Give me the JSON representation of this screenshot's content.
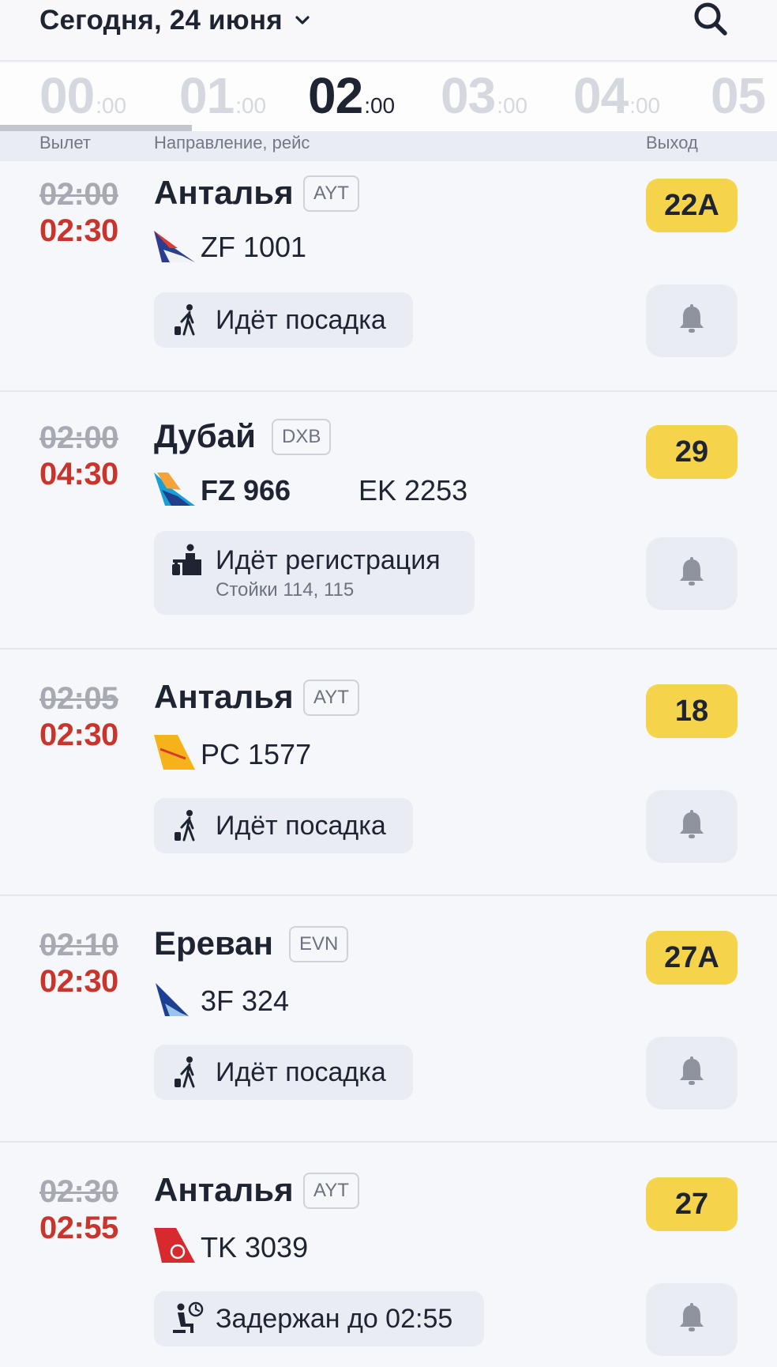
{
  "header": {
    "date_label": "Сегодня, 24 июня"
  },
  "hours": [
    {
      "h": "00",
      "m": ":00",
      "active": false
    },
    {
      "h": "01",
      "m": ":00",
      "active": false
    },
    {
      "h": "02",
      "m": ":00",
      "active": true
    },
    {
      "h": "03",
      "m": ":00",
      "active": false
    },
    {
      "h": "04",
      "m": ":00",
      "active": false
    },
    {
      "h": "05",
      "m": "",
      "active": false
    }
  ],
  "columns": {
    "departure": "Вылет",
    "destination": "Направление, рейс",
    "gate": "Выход"
  },
  "flights": [
    {
      "scheduled": "02:00",
      "actual": "02:30",
      "destination": "Анталья",
      "iata": "AYT",
      "airline_logo": "azur-air-logo",
      "flight": "ZF 1001",
      "codeshare": "",
      "status_icon": "boarding-icon",
      "status": "Идёт посадка",
      "status_sub": "",
      "gate": "22A"
    },
    {
      "scheduled": "02:00",
      "actual": "04:30",
      "destination": "Дубай",
      "iata": "DXB",
      "airline_logo": "flydubai-logo",
      "flight": "FZ 966",
      "codeshare": "EK 2253",
      "status_icon": "check-in-icon",
      "status": "Идёт регистрация",
      "status_sub": "Стойки 114, 115",
      "gate": "29"
    },
    {
      "scheduled": "02:05",
      "actual": "02:30",
      "destination": "Анталья",
      "iata": "AYT",
      "airline_logo": "pegasus-logo",
      "flight": "PC 1577",
      "codeshare": "",
      "status_icon": "boarding-icon",
      "status": "Идёт посадка",
      "status_sub": "",
      "gate": "18"
    },
    {
      "scheduled": "02:10",
      "actual": "02:30",
      "destination": "Ереван",
      "iata": "EVN",
      "airline_logo": "flyone-logo",
      "flight": "3F 324",
      "codeshare": "",
      "status_icon": "boarding-icon",
      "status": "Идёт посадка",
      "status_sub": "",
      "gate": "27A"
    },
    {
      "scheduled": "02:30",
      "actual": "02:55",
      "destination": "Анталья",
      "iata": "AYT",
      "airline_logo": "turkish-airlines-logo",
      "flight": "TK 3039",
      "codeshare": "",
      "status_icon": "delayed-icon",
      "status": "Задержан до 02:55",
      "status_sub": "",
      "gate": "27"
    }
  ],
  "colors": {
    "delayed_time": "#c9352c",
    "gate_badge": "#f5d34b",
    "text": "#1f2433",
    "muted": "#a7aab3"
  }
}
